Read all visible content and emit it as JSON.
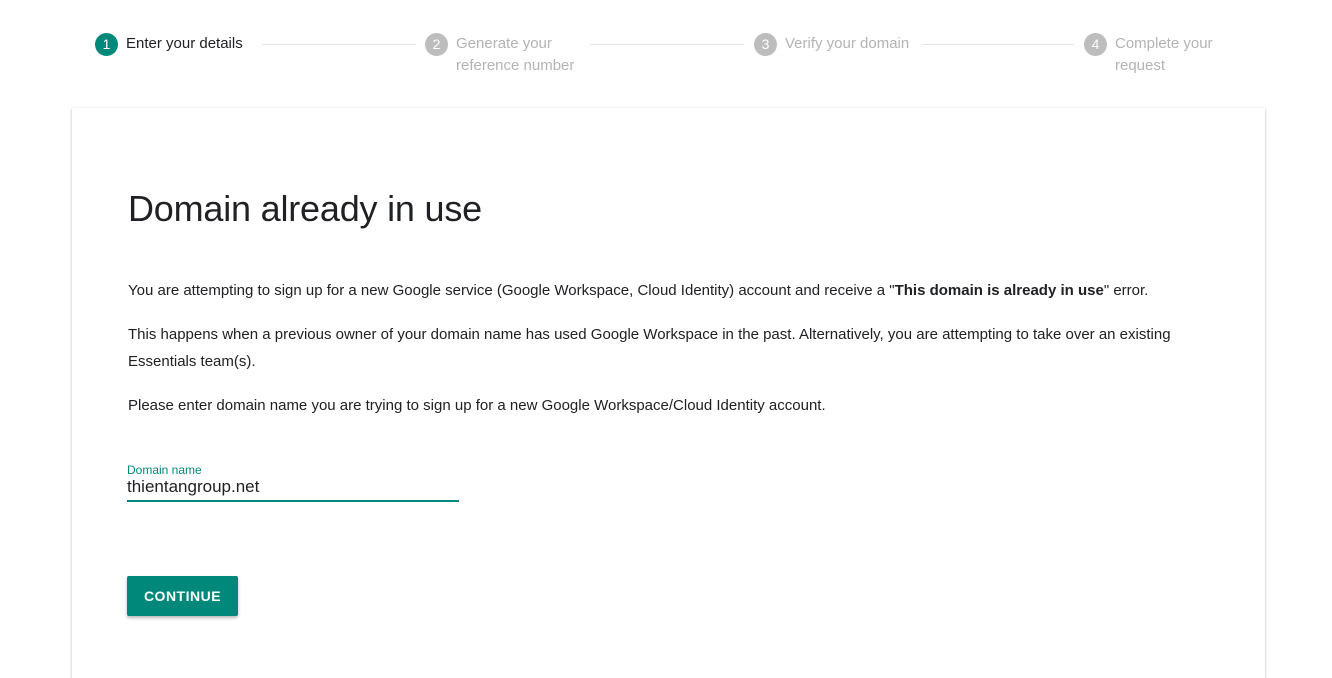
{
  "stepper": {
    "steps": [
      {
        "number": "1",
        "label_line1": "Enter your details",
        "label_line2": "",
        "state": "active"
      },
      {
        "number": "2",
        "label_line1": "Generate your",
        "label_line2": "reference number",
        "state": "inactive"
      },
      {
        "number": "3",
        "label_line1": "Verify your domain",
        "label_line2": "",
        "state": "inactive"
      },
      {
        "number": "4",
        "label_line1": "Complete your",
        "label_line2": "request",
        "state": "inactive"
      }
    ]
  },
  "main": {
    "title": "Domain already in use",
    "p1_before": "You are attempting to sign up for a new Google service (Google Workspace, Cloud Identity) account and receive a \"",
    "p1_bold": "This domain is already in use",
    "p1_after": "\" error.",
    "p2": "This happens when a previous owner of your domain name has used Google Workspace in the past. Alternatively, you are attempting to take over an existing Essentials team(s).",
    "p3": "Please enter domain name you are trying to sign up for a new Google Workspace/Cloud Identity account.",
    "domain_field": {
      "label": "Domain name",
      "value": "thientangroup.net"
    },
    "continue_label": "CONTINUE"
  },
  "colors": {
    "accent": "#00897b",
    "inactive_step": "#bdbdbd",
    "text": "#202124"
  }
}
